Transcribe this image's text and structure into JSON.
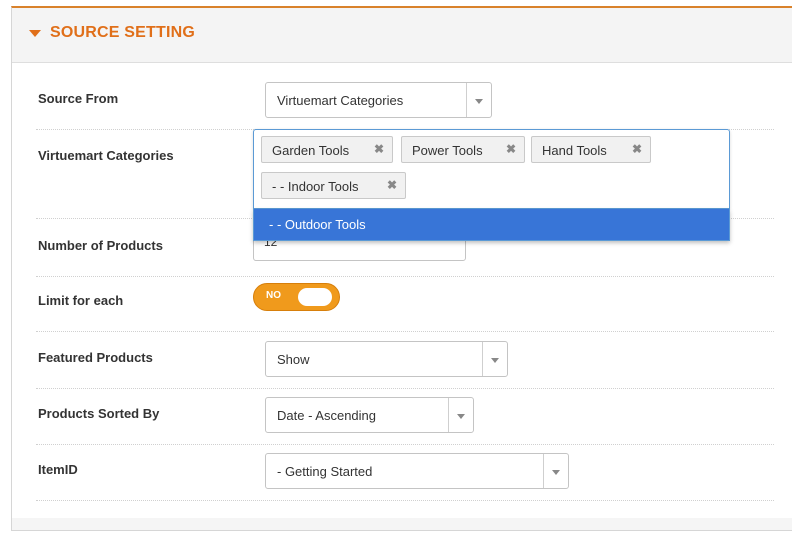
{
  "panel": {
    "title": "SOURCE SETTING"
  },
  "fields": {
    "source_from": {
      "label": "Source From",
      "value": "Virtuemart Categories"
    },
    "categories": {
      "label": "Virtuemart Categories",
      "tags": [
        "Garden Tools",
        "Power Tools",
        "Hand Tools",
        "- - Indoor Tools"
      ],
      "remove_glyph": "✖",
      "dropdown_option": "- - Outdoor Tools"
    },
    "num_products": {
      "label": "Number of Products",
      "value": "12"
    },
    "limit_each": {
      "label": "Limit for each",
      "toggle_text": "NO"
    },
    "featured": {
      "label": "Featured Products",
      "value": "Show"
    },
    "sorted_by": {
      "label": "Products Sorted By",
      "value": "Date - Ascending"
    },
    "itemid": {
      "label": "ItemID",
      "value": "- Getting Started"
    }
  },
  "colors": {
    "accent": "#e06f19",
    "toggle": "#f09a1c",
    "highlight": "#3875d7",
    "focus_border": "#5b9ad5"
  }
}
